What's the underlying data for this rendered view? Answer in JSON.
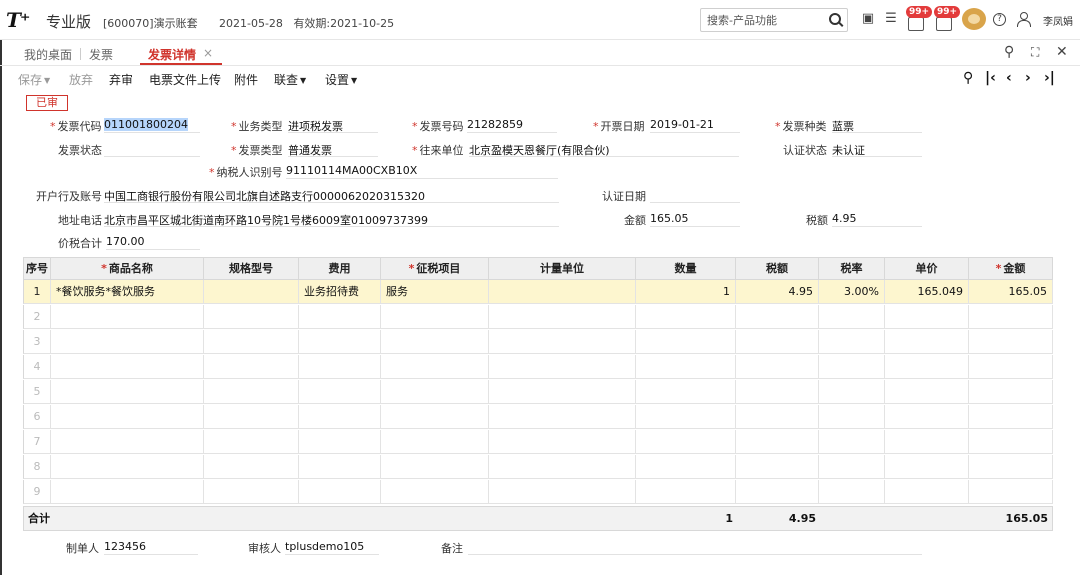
{
  "header": {
    "logo": "T⁺",
    "edition": "专业版",
    "account": "[600070]演示账套",
    "date": "2021-05-28",
    "validity": "有效期:2021-10-25",
    "search_placeholder": "搜索-产品功能",
    "badge1": "99+",
    "badge2": "99+",
    "user": "李凤娟"
  },
  "tabs": [
    {
      "label": "我的桌面"
    },
    {
      "label": "发票"
    },
    {
      "label": "发票详情"
    }
  ],
  "toolbar": {
    "save": "保存",
    "discard": "放弃",
    "unaudit": "弃审",
    "upload": "电票文件上传",
    "attach": "附件",
    "query": "联查",
    "settings": "设置"
  },
  "status_stamp": "已审",
  "form": {
    "invoice_code_label": "发票代码",
    "invoice_code": "011001800204",
    "biz_type_label": "业务类型",
    "biz_type": "进项税发票",
    "invoice_no_label": "发票号码",
    "invoice_no": "21282859",
    "issue_date_label": "开票日期",
    "issue_date": "2019-01-21",
    "invoice_kind_label": "发票种类",
    "invoice_kind": "蓝票",
    "invoice_status_label": "发票状态",
    "invoice_status": "",
    "invoice_type_label": "发票类型",
    "invoice_type": "普通发票",
    "partner_label": "往来单位",
    "partner": "北京盈模天恩餐厅(有限合伙)",
    "cert_status_label": "认证状态",
    "cert_status": "未认证",
    "taxpayer_id_label": "纳税人识别号",
    "taxpayer_id": "91110114MA00CXB10X",
    "bank_label": "开户行及账号",
    "bank": "中国工商银行股份有限公司北旗自述路支行0000062020315320",
    "cert_date_label": "认证日期",
    "cert_date": "",
    "address_label": "地址电话",
    "address": "北京市昌平区城北街道南环路10号院1号楼6009室01009737399",
    "amount_label": "金额",
    "amount": "165.05",
    "tax_label": "税额",
    "tax": "4.95",
    "total_label": "价税合计",
    "total": "170.00"
  },
  "table": {
    "columns": [
      "序号",
      "商品名称",
      "规格型号",
      "费用",
      "征税项目",
      "计量单位",
      "数量",
      "税额",
      "税率",
      "单价",
      "金额"
    ],
    "rows": [
      [
        "1",
        "*餐饮服务*餐饮服务",
        "",
        "业务招待费",
        "服务",
        "",
        "1",
        "4.95",
        "3.00%",
        "165.049",
        "165.05"
      ],
      [
        "2",
        "",
        "",
        "",
        "",
        "",
        "",
        "",
        "",
        "",
        ""
      ],
      [
        "3",
        "",
        "",
        "",
        "",
        "",
        "",
        "",
        "",
        "",
        ""
      ],
      [
        "4",
        "",
        "",
        "",
        "",
        "",
        "",
        "",
        "",
        "",
        ""
      ],
      [
        "5",
        "",
        "",
        "",
        "",
        "",
        "",
        "",
        "",
        "",
        ""
      ],
      [
        "6",
        "",
        "",
        "",
        "",
        "",
        "",
        "",
        "",
        "",
        ""
      ],
      [
        "7",
        "",
        "",
        "",
        "",
        "",
        "",
        "",
        "",
        "",
        ""
      ],
      [
        "8",
        "",
        "",
        "",
        "",
        "",
        "",
        "",
        "",
        "",
        ""
      ],
      [
        "9",
        "",
        "",
        "",
        "",
        "",
        "",
        "",
        "",
        "",
        ""
      ]
    ],
    "totals": {
      "label": "合计",
      "qty": "1",
      "tax": "4.95",
      "amount": "165.05"
    }
  },
  "footer": {
    "maker_label": "制单人",
    "maker": "123456",
    "auditor_label": "审核人",
    "auditor": "tplusdemo105",
    "remark_label": "备注",
    "remark": ""
  }
}
